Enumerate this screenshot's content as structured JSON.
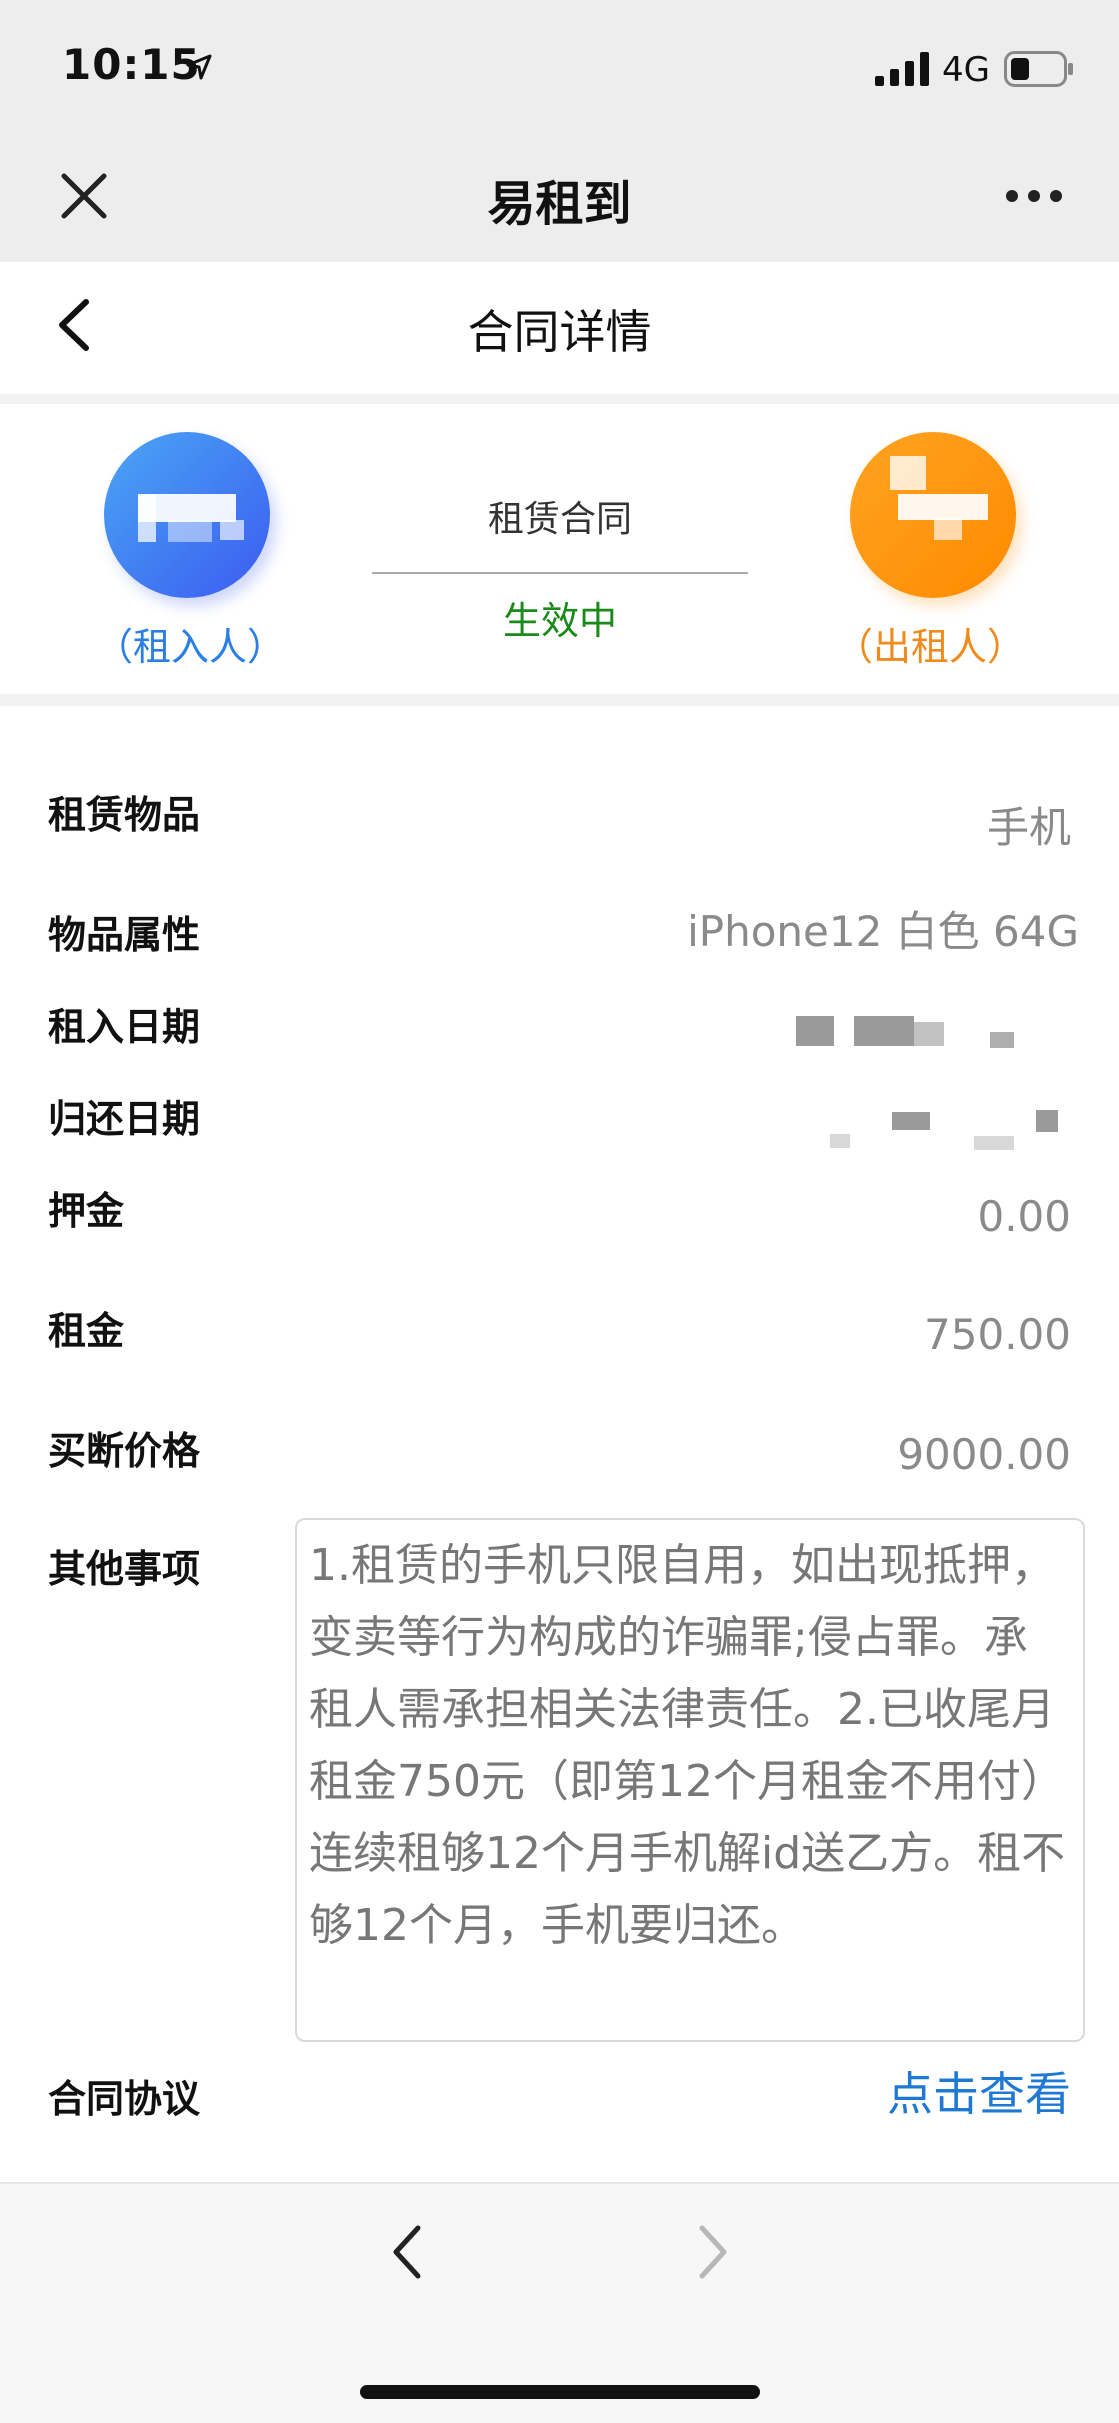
{
  "status_bar": {
    "time": "10:15",
    "network": "4G",
    "icons": [
      "location-arrow-icon",
      "signal-icon",
      "battery-icon"
    ]
  },
  "wechat_bar": {
    "title": "易租到",
    "icons": [
      "close-icon",
      "more-icon"
    ]
  },
  "nav": {
    "title": "合同详情",
    "icons": [
      "back-icon"
    ]
  },
  "parties": {
    "renter_label": "（租入人）",
    "lessor_label": "（出租人）",
    "contract_name": "租赁合同",
    "contract_status": "生效中"
  },
  "details": {
    "item_label": "租赁物品",
    "item_value": "手机",
    "attr_label": "物品属性",
    "attr_value": "iPhone12 白色 64G",
    "start_label": "租入日期",
    "return_label": "归还日期",
    "deposit_label": "押金",
    "deposit_value": "0.00",
    "rent_label": "租金",
    "rent_value": "750.00",
    "buyout_label": "买断价格",
    "buyout_value": "9000.00",
    "notes_label": "其他事项",
    "notes_value": "1.租赁的手机只限自用，如出现抵押，变卖等行为构成的诈骗罪;侵占罪。承租人需承担相关法律责任。2.已收尾月租金750元（即第12个月租金不用付）连续租够12个月手机解id送乙方。租不够12个月，手机要归还。",
    "agreement_label": "合同协议",
    "agreement_link": "点击查看"
  },
  "toolbar": {
    "icons": [
      "prev-arrow-icon",
      "next-arrow-icon"
    ]
  },
  "colors": {
    "renter": "#2a7ee6",
    "lessor": "#f08a1c",
    "status_active": "#1a8a1a",
    "link": "#1f78d1"
  }
}
